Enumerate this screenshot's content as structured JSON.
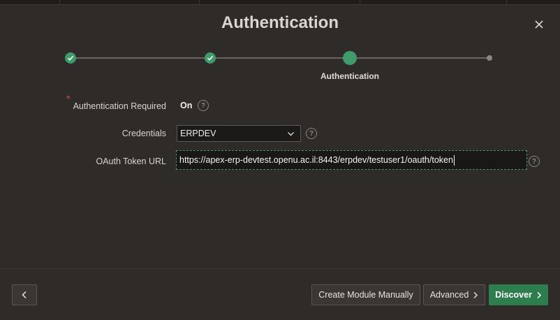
{
  "dialog": {
    "title": "Authentication",
    "close_icon": "close-icon"
  },
  "wizard": {
    "steps": [
      {
        "state": "complete",
        "icon": "check-icon"
      },
      {
        "state": "complete",
        "icon": "check-icon"
      },
      {
        "state": "current",
        "label": "Authentication"
      },
      {
        "state": "upcoming"
      }
    ],
    "accent_color": "#3f9b6a"
  },
  "form": {
    "auth_required": {
      "label": "Authentication Required",
      "value": "On",
      "required_marker": "*",
      "help": "?"
    },
    "credentials": {
      "label": "Credentials",
      "value": "ERPDEV",
      "help": "?"
    },
    "oauth_token_url": {
      "label": "OAuth Token URL",
      "value": "https://apex-erp-devtest.openu.ac.il:8443/erpdev/testuser1/oauth/token",
      "help": "?"
    }
  },
  "footer": {
    "back_icon": "chevron-left-icon",
    "create_manually_label": "Create Module Manually",
    "advanced_label": "Advanced",
    "discover_label": "Discover",
    "primary_color": "#2e7d4f"
  }
}
